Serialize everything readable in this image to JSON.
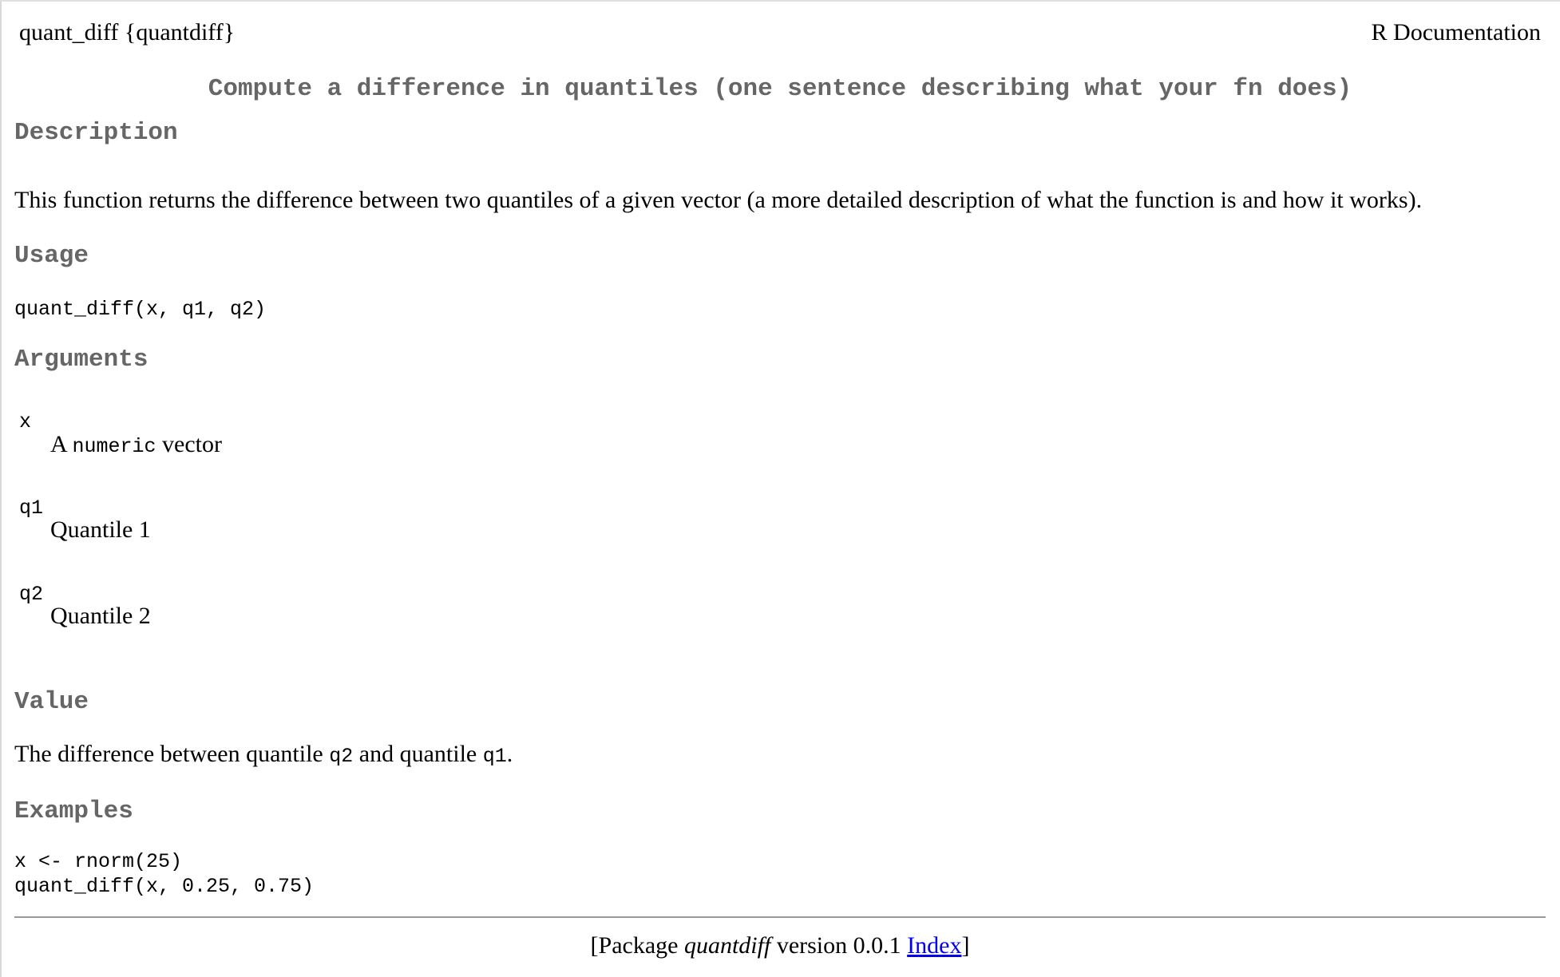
{
  "header": {
    "topic": "quant_diff {quantdiff}",
    "right_label": "R Documentation"
  },
  "title": "Compute a difference in quantiles (one sentence describing what your fn does)",
  "sections": {
    "description": {
      "heading": "Description",
      "text": "This function returns the difference between two quantiles of a given vector (a more detailed description of what the function is and how it works)."
    },
    "usage": {
      "heading": "Usage",
      "code": "quant_diff(x, q1, q2)"
    },
    "arguments": {
      "heading": "Arguments",
      "items": [
        {
          "name": "x",
          "desc_prefix": "A ",
          "desc_code": "numeric",
          "desc_suffix": " vector"
        },
        {
          "name": "q1",
          "desc": "Quantile 1"
        },
        {
          "name": "q2",
          "desc": "Quantile 2"
        }
      ]
    },
    "value": {
      "heading": "Value",
      "text_prefix": "The difference between quantile ",
      "code_1": "q2",
      "text_mid": " and quantile ",
      "code_2": "q1",
      "text_suffix": "."
    },
    "examples": {
      "heading": "Examples",
      "lines": [
        "x <- rnorm(25)",
        "quant_diff(x, 0.25, 0.75)"
      ]
    }
  },
  "footer": {
    "prefix": "[Package ",
    "package_name": "quantdiff",
    "version_text": " version 0.0.1 ",
    "index_link": "Index",
    "suffix": "]"
  }
}
